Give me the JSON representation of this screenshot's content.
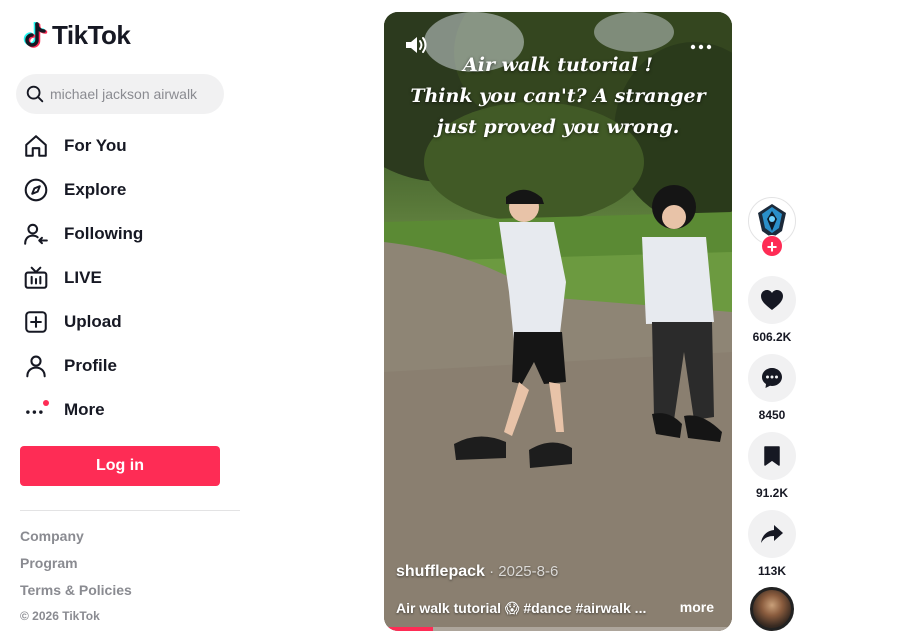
{
  "app": {
    "name": "TikTok"
  },
  "search": {
    "placeholder": "michael jackson airwalk"
  },
  "nav": {
    "items": [
      {
        "label": "For You",
        "icon": "home-icon"
      },
      {
        "label": "Explore",
        "icon": "compass-icon"
      },
      {
        "label": "Following",
        "icon": "following-icon"
      },
      {
        "label": "LIVE",
        "icon": "live-tv-icon"
      },
      {
        "label": "Upload",
        "icon": "upload-plus-icon"
      },
      {
        "label": "Profile",
        "icon": "profile-icon"
      },
      {
        "label": "More",
        "icon": "more-dots-icon"
      }
    ]
  },
  "login": {
    "label": "Log in"
  },
  "footer": {
    "links": [
      "Company",
      "Program",
      "Terms & Policies"
    ],
    "copyright": "© 2026 TikTok"
  },
  "video": {
    "caption_lines": [
      "Air walk tutorial !",
      "Think you can't? A stranger",
      "just proved you wrong."
    ],
    "author": "shufflepack",
    "date": "2025-8-6",
    "description": "Air walk tutorial 😱 #dance #airwalk ...",
    "more_label": "more",
    "progress": 0.14
  },
  "actions": {
    "likes": "606.2K",
    "comments": "8450",
    "saves": "91.2K",
    "shares": "113K"
  },
  "colors": {
    "brand": "#fe2c55",
    "text": "#161823",
    "muted": "#8a8b91",
    "surface": "#f1f1f2"
  }
}
